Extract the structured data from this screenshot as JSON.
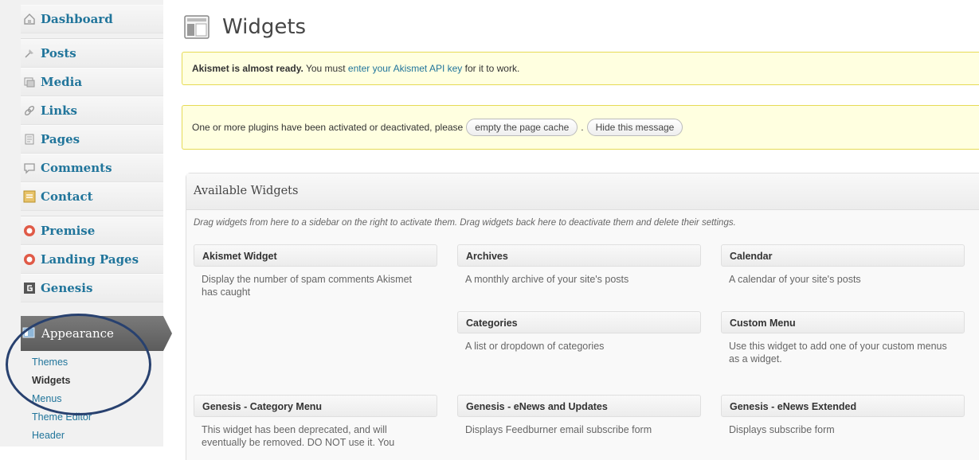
{
  "sidebar": {
    "items": [
      {
        "label": "Dashboard",
        "icon": "dashboard-icon"
      },
      {
        "label": "Posts",
        "icon": "posts-pin-icon"
      },
      {
        "label": "Media",
        "icon": "media-icon"
      },
      {
        "label": "Links",
        "icon": "links-icon"
      },
      {
        "label": "Pages",
        "icon": "pages-icon"
      },
      {
        "label": "Comments",
        "icon": "comments-icon"
      },
      {
        "label": "Contact",
        "icon": "contact-icon"
      },
      {
        "label": "Premise",
        "icon": "premise-icon"
      },
      {
        "label": "Landing Pages",
        "icon": "landing-pages-icon"
      },
      {
        "label": "Genesis",
        "icon": "genesis-icon"
      }
    ],
    "appearance": {
      "label": "Appearance",
      "icon": "appearance-icon"
    },
    "submenu": [
      {
        "label": "Themes"
      },
      {
        "label": "Widgets"
      },
      {
        "label": "Menus"
      },
      {
        "label": "Theme Editor"
      },
      {
        "label": "Header"
      }
    ]
  },
  "header": {
    "title": "Widgets",
    "icon": "widgets-icon"
  },
  "notices": {
    "akismet": {
      "bold": "Akismet is almost ready.",
      "before": " You must ",
      "link": "enter your Akismet API key",
      "after": " for it to work."
    },
    "cache": {
      "text": "One or more plugins have been activated or deactivated, please",
      "button1": "empty the page cache",
      "separator": ".",
      "button2": "Hide this message"
    }
  },
  "available": {
    "title": "Available Widgets",
    "description": "Drag widgets from here to a sidebar on the right to activate them. Drag widgets back here to deactivate them and delete their settings.",
    "widgets": [
      {
        "title": "Akismet Widget",
        "desc": "Display the number of spam comments Akismet has caught"
      },
      {
        "title": "Archives",
        "desc": "A monthly archive of your site's posts"
      },
      {
        "title": "Calendar",
        "desc": "A calendar of your site's posts"
      },
      {
        "title": "Categories",
        "desc": "A list or dropdown of categories"
      },
      {
        "title": "Custom Menu",
        "desc": "Use this widget to add one of your custom menus as a widget."
      },
      {
        "title": "Genesis - Category Menu",
        "desc": "This widget has been deprecated, and will eventually be removed. DO NOT use it. You"
      },
      {
        "title": "Genesis - eNews and Updates",
        "desc": "Displays Feedburner email subscribe form"
      },
      {
        "title": "Genesis - eNews Extended",
        "desc": "Displays subscribe form"
      }
    ]
  },
  "colors": {
    "link": "#21759b",
    "notice_bg": "#ffffe0",
    "notice_border": "#e6db55",
    "appearance_bg": "#6b6b6b",
    "annotation": "#28416f"
  }
}
